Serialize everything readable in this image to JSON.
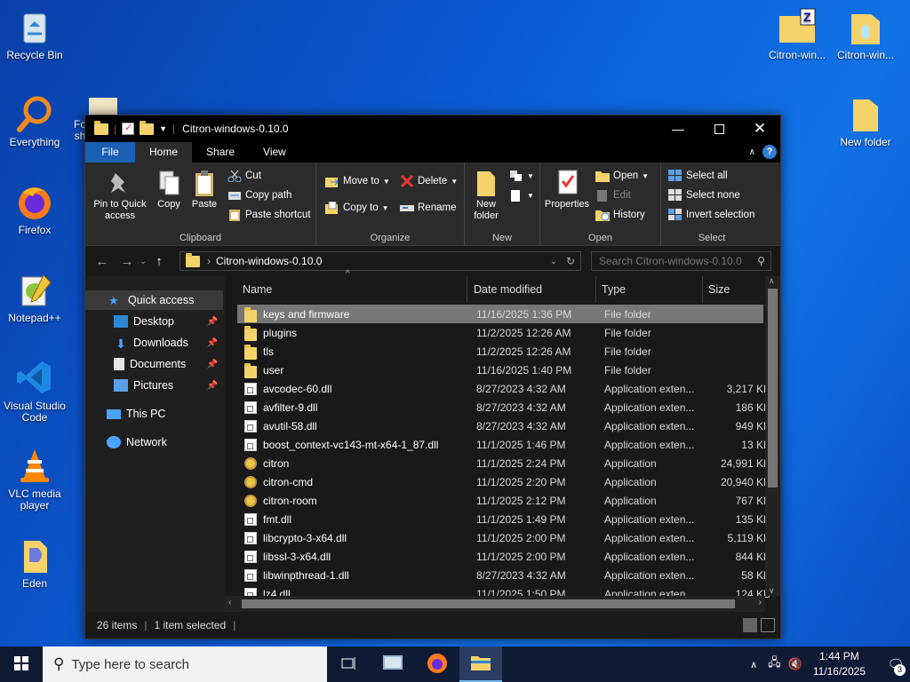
{
  "desktop": {
    "icons": [
      {
        "label": "Recycle Bin"
      },
      {
        "label": "Everything"
      },
      {
        "label": "Firefox"
      },
      {
        "label": "Notepad++"
      },
      {
        "label": "Visual Studio Code"
      },
      {
        "label": "VLC media player"
      },
      {
        "label": "Eden"
      },
      {
        "label": "Citron-win..."
      },
      {
        "label": "Citron-win..."
      },
      {
        "label": "New folder"
      },
      {
        "label": "Fo sh"
      }
    ]
  },
  "window": {
    "title": "Citron-windows-0.10.0",
    "tabs": [
      "File",
      "Home",
      "Share",
      "View"
    ],
    "ribbon": {
      "clipboard": {
        "pin": "Pin to Quick access",
        "copy": "Copy",
        "paste": "Paste",
        "cut": "Cut",
        "copy_path": "Copy path",
        "paste_shortcut": "Paste shortcut",
        "label": "Clipboard"
      },
      "organize": {
        "move_to": "Move to",
        "copy_to": "Copy to",
        "delete": "Delete",
        "rename": "Rename",
        "label": "Organize"
      },
      "new": {
        "new_folder": "New folder",
        "label": "New"
      },
      "open": {
        "properties": "Properties",
        "open": "Open",
        "edit": "Edit",
        "history": "History",
        "label": "Open"
      },
      "select": {
        "select_all": "Select all",
        "select_none": "Select none",
        "invert": "Invert selection",
        "label": "Select"
      }
    },
    "address": {
      "path": "Citron-windows-0.10.0",
      "search_placeholder": "Search Citron-windows-0.10.0"
    },
    "nav": {
      "quick_access": "Quick access",
      "items": [
        "Desktop",
        "Downloads",
        "Documents",
        "Pictures"
      ],
      "this_pc": "This PC",
      "network": "Network"
    },
    "columns": {
      "name": "Name",
      "date": "Date modified",
      "type": "Type",
      "size": "Size"
    },
    "files": [
      {
        "name": "keys and firmware",
        "date": "11/16/2025 1:36 PM",
        "type": "File folder",
        "size": "",
        "kind": "folder"
      },
      {
        "name": "plugins",
        "date": "11/2/2025 12:26 AM",
        "type": "File folder",
        "size": "",
        "kind": "folder"
      },
      {
        "name": "tls",
        "date": "11/2/2025 12:26 AM",
        "type": "File folder",
        "size": "",
        "kind": "folder"
      },
      {
        "name": "user",
        "date": "11/16/2025 1:40 PM",
        "type": "File folder",
        "size": "",
        "kind": "folder"
      },
      {
        "name": "avcodec-60.dll",
        "date": "8/27/2023 4:32 AM",
        "type": "Application exten...",
        "size": "3,217 KB",
        "kind": "dll"
      },
      {
        "name": "avfilter-9.dll",
        "date": "8/27/2023 4:32 AM",
        "type": "Application exten...",
        "size": "186 KB",
        "kind": "dll"
      },
      {
        "name": "avutil-58.dll",
        "date": "8/27/2023 4:32 AM",
        "type": "Application exten...",
        "size": "949 KB",
        "kind": "dll"
      },
      {
        "name": "boost_context-vc143-mt-x64-1_87.dll",
        "date": "11/1/2025 1:46 PM",
        "type": "Application exten...",
        "size": "13 KB",
        "kind": "dll"
      },
      {
        "name": "citron",
        "date": "11/1/2025 2:24 PM",
        "type": "Application",
        "size": "24,991 KB",
        "kind": "exe"
      },
      {
        "name": "citron-cmd",
        "date": "11/1/2025 2:20 PM",
        "type": "Application",
        "size": "20,940 KB",
        "kind": "exe"
      },
      {
        "name": "citron-room",
        "date": "11/1/2025 2:12 PM",
        "type": "Application",
        "size": "767 KB",
        "kind": "exe"
      },
      {
        "name": "fmt.dll",
        "date": "11/1/2025 1:49 PM",
        "type": "Application exten...",
        "size": "135 KB",
        "kind": "dll"
      },
      {
        "name": "libcrypto-3-x64.dll",
        "date": "11/1/2025 2:00 PM",
        "type": "Application exten...",
        "size": "5,119 KB",
        "kind": "dll"
      },
      {
        "name": "libssl-3-x64.dll",
        "date": "11/1/2025 2:00 PM",
        "type": "Application exten...",
        "size": "844 KB",
        "kind": "dll"
      },
      {
        "name": "libwinpthread-1.dll",
        "date": "8/27/2023 4:32 AM",
        "type": "Application exten...",
        "size": "58 KB",
        "kind": "dll"
      },
      {
        "name": "lz4.dll",
        "date": "11/1/2025 1:50 PM",
        "type": "Application exten...",
        "size": "124 KB",
        "kind": "dll"
      }
    ],
    "status": {
      "items": "26 items",
      "selected": "1 item selected"
    }
  },
  "taskbar": {
    "search_placeholder": "Type here to search",
    "time": "1:44 PM",
    "date": "11/16/2025",
    "notifications": "3"
  }
}
